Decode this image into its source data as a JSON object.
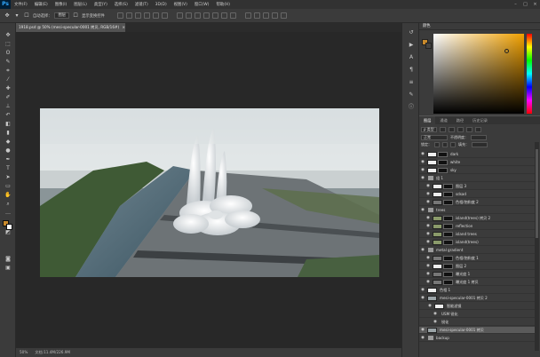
{
  "menu": {
    "logo": "Ps",
    "items": [
      "文件(F)",
      "编辑(E)",
      "图像(I)",
      "图层(L)",
      "类型(Y)",
      "选择(S)",
      "滤镜(T)",
      "3D(D)",
      "视图(V)",
      "窗口(W)",
      "帮助(H)"
    ]
  },
  "options": {
    "auto_select_label": "自动选择：",
    "auto_select_value": "图层",
    "transform_label": "显示变换控件"
  },
  "document": {
    "tab_title": "1918.psd @ 50% (mesi-specular-0001 拷贝, RGB/16#)",
    "close": "×"
  },
  "status": {
    "zoom": "50%",
    "doc_size": "文档:11.4M/226.9M"
  },
  "color_panel": {
    "tab": "颜色",
    "fg_color": "#c98a2c",
    "bg_color": "#444444"
  },
  "layers_panel": {
    "tabs": [
      "图层",
      "通道",
      "路径",
      "历史记录"
    ],
    "filter": "ρ 类型",
    "blend_mode": "正常",
    "opacity_label": "不透明度：",
    "lock_label": "锁定：",
    "fill_label": "填充：",
    "layers": [
      {
        "name": "dark",
        "type": "layer"
      },
      {
        "name": "white",
        "type": "layer"
      },
      {
        "name": "sky",
        "type": "layer"
      },
      {
        "name": "组 1",
        "type": "group"
      },
      {
        "name": "图层 3",
        "type": "layer"
      },
      {
        "name": "sdsad",
        "type": "layer"
      },
      {
        "name": "色相/饱和度 2",
        "type": "adjust"
      },
      {
        "name": "trees",
        "type": "group"
      },
      {
        "name": "island(trees) 拷贝 2",
        "type": "layer"
      },
      {
        "name": "reflection",
        "type": "layer"
      },
      {
        "name": "island trees",
        "type": "layer"
      },
      {
        "name": "island(trees)",
        "type": "layer"
      },
      {
        "name": "metal gradient",
        "type": "group"
      },
      {
        "name": "色相/饱和度 1",
        "type": "adjust"
      },
      {
        "name": "图层 2",
        "type": "layer"
      },
      {
        "name": "曝光度 1",
        "type": "adjust"
      },
      {
        "name": "曝光度 1 拷贝",
        "type": "adjust"
      },
      {
        "name": "色相 1",
        "type": "layer"
      },
      {
        "name": "mesi-specular-0001 拷贝 2",
        "type": "layer"
      },
      {
        "name": "智能滤镜",
        "type": "filter"
      },
      {
        "name": "USM 锐化",
        "type": "filter"
      },
      {
        "name": "锐化",
        "type": "filter"
      },
      {
        "name": "mesi-specular-0001 拷贝",
        "type": "layer",
        "selected": true
      },
      {
        "name": "backup",
        "type": "group"
      }
    ]
  }
}
